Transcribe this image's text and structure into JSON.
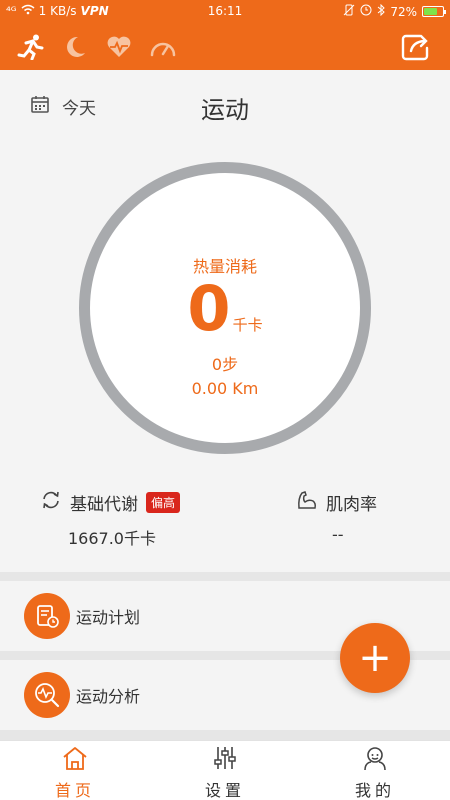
{
  "status_bar": {
    "signal": "⁴ᴳ",
    "speed": "1 KB/s",
    "vpn": "VPN",
    "time": "16:11",
    "battery": "72%",
    "battery_level": 0.72
  },
  "header": {
    "icons": [
      "running-icon",
      "moon-icon",
      "heart-rate-icon",
      "gauge-icon"
    ],
    "share_icon": "share-icon"
  },
  "page": {
    "date_label": "今天",
    "title": "运动"
  },
  "summary": {
    "calorie_label": "热量消耗",
    "calorie_value": "0",
    "calorie_unit": "千卡",
    "steps": "0步",
    "distance": "0.00 Km"
  },
  "metrics": {
    "bmr_label": "基础代谢",
    "bmr_badge": "偏高",
    "bmr_value": "1667.0千卡",
    "muscle_label": "肌肉率",
    "muscle_value": "--"
  },
  "cards": [
    {
      "label": "运动计划"
    },
    {
      "label": "运动分析"
    }
  ],
  "fab": {
    "label": "+"
  },
  "nav": [
    {
      "label": "首页",
      "active": true
    },
    {
      "label": "设置",
      "active": false
    },
    {
      "label": "我的",
      "active": false
    }
  ],
  "colors": {
    "accent": "#ee6a1a",
    "badge": "#d9261c",
    "ring": "#a8aaad"
  }
}
